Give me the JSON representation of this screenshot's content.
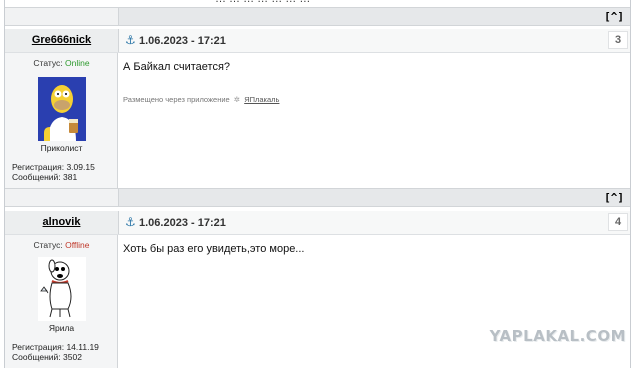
{
  "top_fragment": "… … … … … … …",
  "to_top_label": "[^]",
  "posts": [
    {
      "author": "Gre666nick",
      "date": "1.06.2023 - 17:21",
      "number": "3",
      "status_label": "Статус:",
      "status_value": "Online",
      "user_title": "Приколист",
      "reg_label": "Регистрация:",
      "reg_value": "3.09.15",
      "msgs_label": "Сообщений:",
      "msgs_value": "381",
      "text": "А Байкал считается?",
      "via_label": "Размещено через приложение",
      "via_app": "ЯПлакаль",
      "avatar_icon": "homer-simpson-avatar"
    },
    {
      "author": "alnovik",
      "date": "1.06.2023 - 17:21",
      "number": "4",
      "status_label": "Статус:",
      "status_value": "Offline",
      "user_title": "Ярила",
      "reg_label": "Регистрация:",
      "reg_value": "14.11.19",
      "msgs_label": "Сообщений:",
      "msgs_value": "3502",
      "text": "Хоть бы раз его увидеть,это море...",
      "avatar_icon": "brian-griffin-avatar"
    }
  ],
  "watermark": "YAPLAKAL.COM",
  "colors": {
    "online": "#2e9a2e",
    "offline": "#c0392b",
    "anchor": "#2f78a8",
    "header_bg": "#e6e8ea"
  }
}
